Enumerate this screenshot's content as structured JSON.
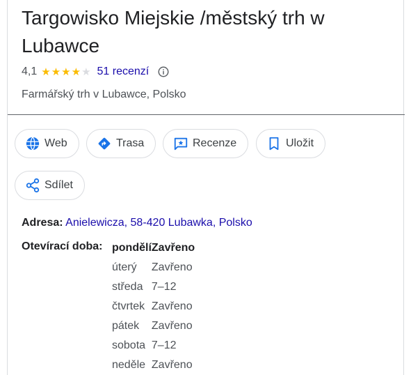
{
  "place": {
    "title": "Targowisko Miejskie /městský trh w Lubawce",
    "rating": "4,1",
    "stars_filled": 4,
    "stars_total": 5,
    "reviews_label": "51 recenzí",
    "category": "Farmářský trh v Lubawce, Polsko"
  },
  "actions": {
    "web": "Web",
    "route": "Trasa",
    "reviews": "Recenze",
    "save": "Uložit",
    "share": "Sdílet"
  },
  "address": {
    "label": "Adresa:",
    "value": "Anielewicza, 58-420 Lubawka, Polsko"
  },
  "hours": {
    "label": "Otevírací doba:",
    "rows": [
      {
        "day": "pondělí",
        "time": "Zavřeno"
      },
      {
        "day": "úterý",
        "time": "Zavřeno"
      },
      {
        "day": "středa",
        "time": "7–12"
      },
      {
        "day": "čtvrtek",
        "time": "Zavřeno"
      },
      {
        "day": "pátek",
        "time": "Zavřeno"
      },
      {
        "day": "sobota",
        "time": "7–12"
      },
      {
        "day": "neděle",
        "time": "Zavřeno"
      }
    ]
  },
  "colors": {
    "accent": "#1a73e8",
    "link": "#1a0dab",
    "star": "#fbbc04",
    "star_empty": "#dadce0"
  }
}
